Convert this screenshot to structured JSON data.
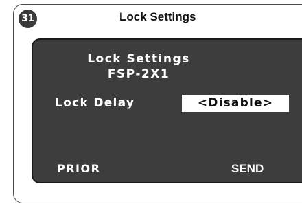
{
  "step": {
    "number": "31",
    "title": "Lock Settings"
  },
  "screen": {
    "title": "Lock Settings",
    "model": "FSP-2X1",
    "lock_delay": {
      "label": "Lock Delay",
      "value": "<Disable>"
    },
    "prior_label": "PRIOR",
    "send_label": "SEND"
  },
  "colors": {
    "screen_background": "#3d3d3d",
    "badge_background": "#3a3a3a",
    "highlight_background": "#ffffff"
  }
}
